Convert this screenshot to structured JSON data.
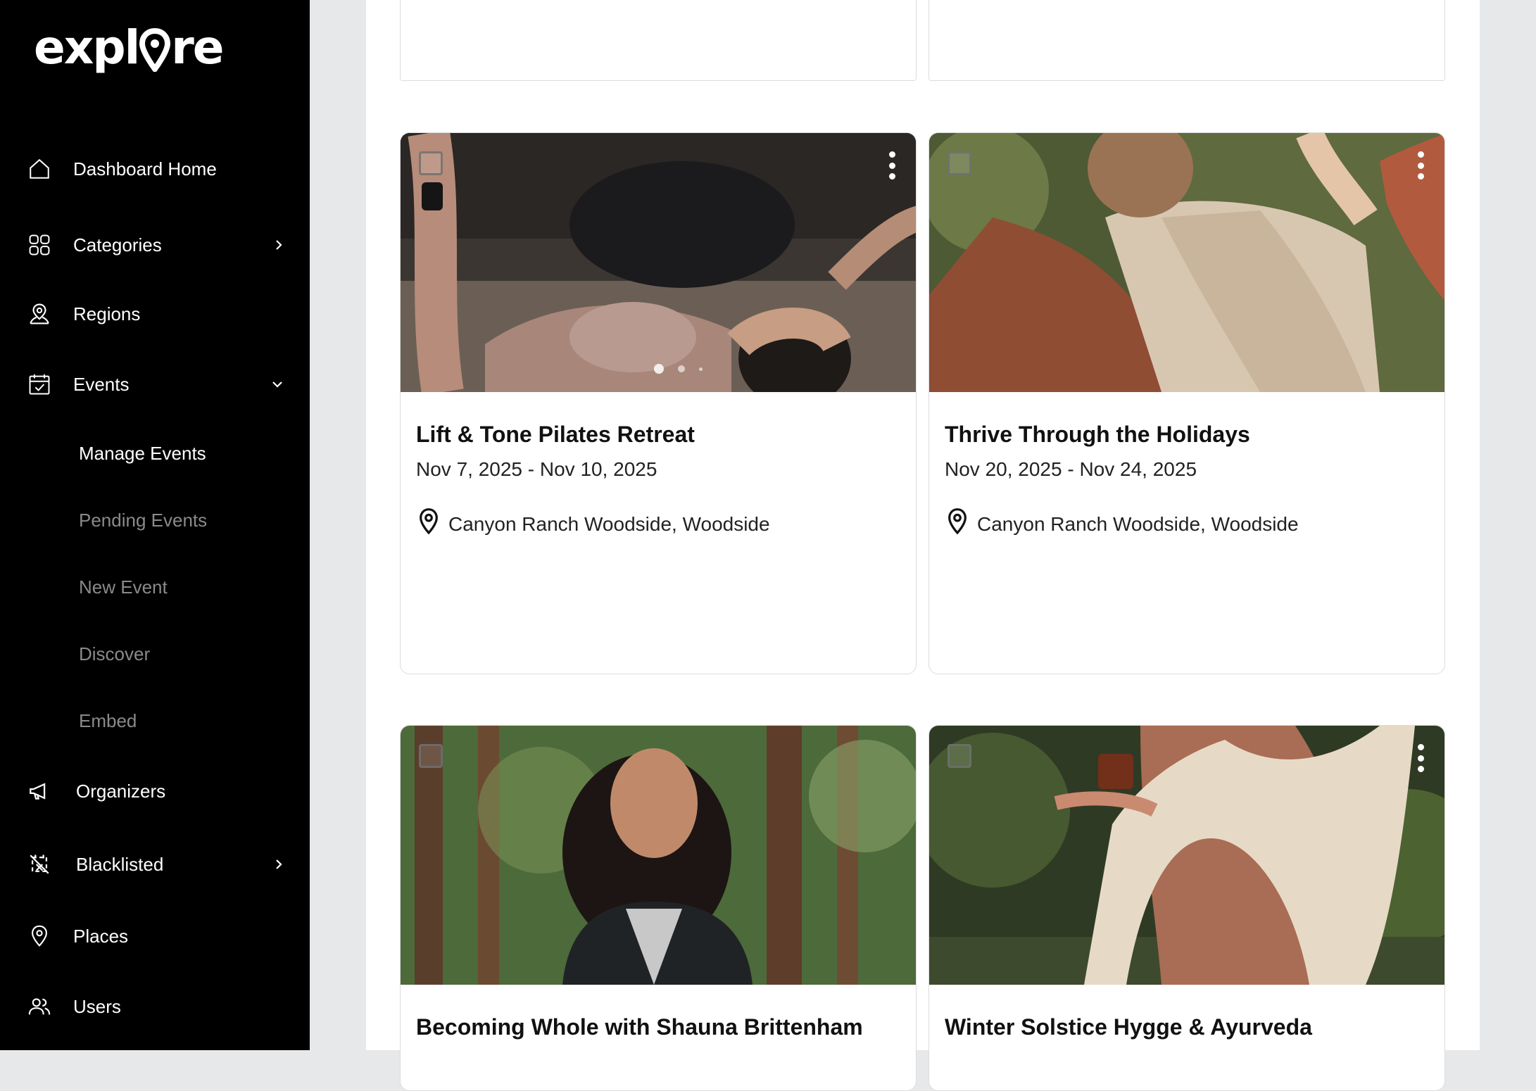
{
  "brand": {
    "logo_text_left": "expl",
    "logo_text_right": "re"
  },
  "sidebar": {
    "items": [
      {
        "label": "Dashboard Home",
        "icon": "home-icon"
      },
      {
        "label": "Categories",
        "icon": "grid-icon",
        "chevron": "chevron-right-icon"
      },
      {
        "label": "Regions",
        "icon": "user-location-icon"
      },
      {
        "label": "Events",
        "icon": "calendar-check-icon",
        "chevron": "chevron-down-icon"
      },
      {
        "label": "Organizers",
        "icon": "megaphone-icon"
      },
      {
        "label": "Blacklisted",
        "icon": "blocked-calendar-icon",
        "chevron": "chevron-right-icon"
      },
      {
        "label": "Places",
        "icon": "map-pin-icon"
      },
      {
        "label": "Users",
        "icon": "users-icon"
      }
    ],
    "events_sub": [
      {
        "label": "Manage Events",
        "active": true
      },
      {
        "label": "Pending Events"
      },
      {
        "label": "New Event"
      },
      {
        "label": "Discover"
      },
      {
        "label": "Embed"
      }
    ]
  },
  "events": [
    {
      "title": "Lift & Tone Pilates Retreat",
      "date": "Nov 7, 2025 - Nov 10, 2025",
      "location": "Canyon Ranch Woodside, Woodside"
    },
    {
      "title": "Thrive Through the Holidays",
      "date": "Nov 20, 2025 - Nov 24, 2025",
      "location": "Canyon Ranch Woodside, Woodside"
    },
    {
      "title": "Becoming Whole with Shauna Brittenham",
      "date": "",
      "location": ""
    },
    {
      "title": "Winter Solstice Hygge & Ayurveda",
      "date": "",
      "location": ""
    }
  ],
  "colors": {
    "sidebar_bg": "#000000",
    "muted_text": "#8a8a8a",
    "page_bg": "#e7e8ea"
  }
}
